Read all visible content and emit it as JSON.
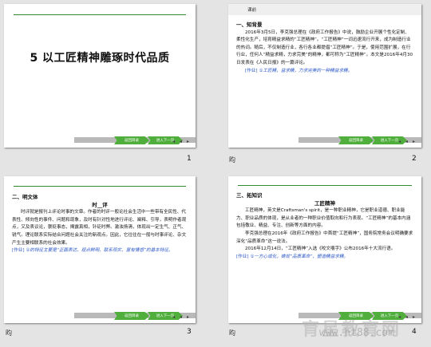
{
  "slides": [
    {
      "number": "1",
      "title": "5 以工匠精神雕琢时代品质",
      "buttons": [
        "返回目录",
        "进入下一页"
      ]
    },
    {
      "number": "2",
      "header": "课前",
      "section": "一、知背景",
      "paragraph": "2016年3月5日，李克强总理在《政府工作报告》中说，鼓励企业开展个性化定制、柔性化生产，培育精益求精的“工匠精神”。“工匠精神”一词迅速流行开来，成为制造行业的热词。随后，不仅制造行业，各行各业都提倡“工匠精神”。于是，使用范围扩展，在行行业，任何人“精益求精，力求完美”的精神，都可称为“工匠精神”。本文是2016年4月30日发表在《人民日报》的一篇评论。",
      "note_label": "[作业]",
      "note": "①工匠精，益求精，力求完美的一种精益求精。",
      "buttons": [
        "返回目录",
        "进入下一页"
      ]
    },
    {
      "number": "3",
      "section": "二、明文体",
      "center": "时__评",
      "paragraph": "时评就是报刊上评论时事的文章。作者的时评一般论社会生活中一些带有全民性、代表性、倾向性的事件、问题和现象，及时有针对性地进行评论、阐释、引导，表明作者观点，又及表议论，褒贬事态，揭露真相，针砭时弊。激浊扬清，体现出一定生气、正气、锐气。理论联系实际结合问题社会关注的新观点。因此，它往往在一般与时事评论、杂文产生主要相联系的社会效果。",
      "note_label": "[作业]",
      "note": "①的特征主要是“正面表达、观点鲜明、联系现实、富有情感”的基本特征。",
      "buttons": [
        "返回目录",
        "进入下一页"
      ]
    },
    {
      "number": "4",
      "section": "三、拓知识",
      "center": "工匠精神",
      "paragraph1": "工匠精神，英文是Craftsman's spirit，是一种职业精神，它是职业道德、职业能力、职业品质的体现，是从业者的一种职业价值取向和行为表现。“工匠精神”的基本内涵包括敬业、精益、专注、创新等方面的内容。",
      "paragraph2": "李克强总理在2016年《政府工作报告》中首提“工匠精神”，国务院常务会议明确要求深化“品质革命”这一说法。",
      "paragraph3": "2016年12月14日，“工匠精神”入选《咬文嚼字》公布2016年十大流行语。",
      "note_label": "[作业]",
      "note": "①一方心或化，铸就“品质革命”，塑造精益求精。",
      "buttons": [
        "返回目录",
        "进入下一页"
      ]
    }
  ],
  "below_label": "昀",
  "watermark": "育星教育网",
  "watermark_url": "www.ht88.com"
}
